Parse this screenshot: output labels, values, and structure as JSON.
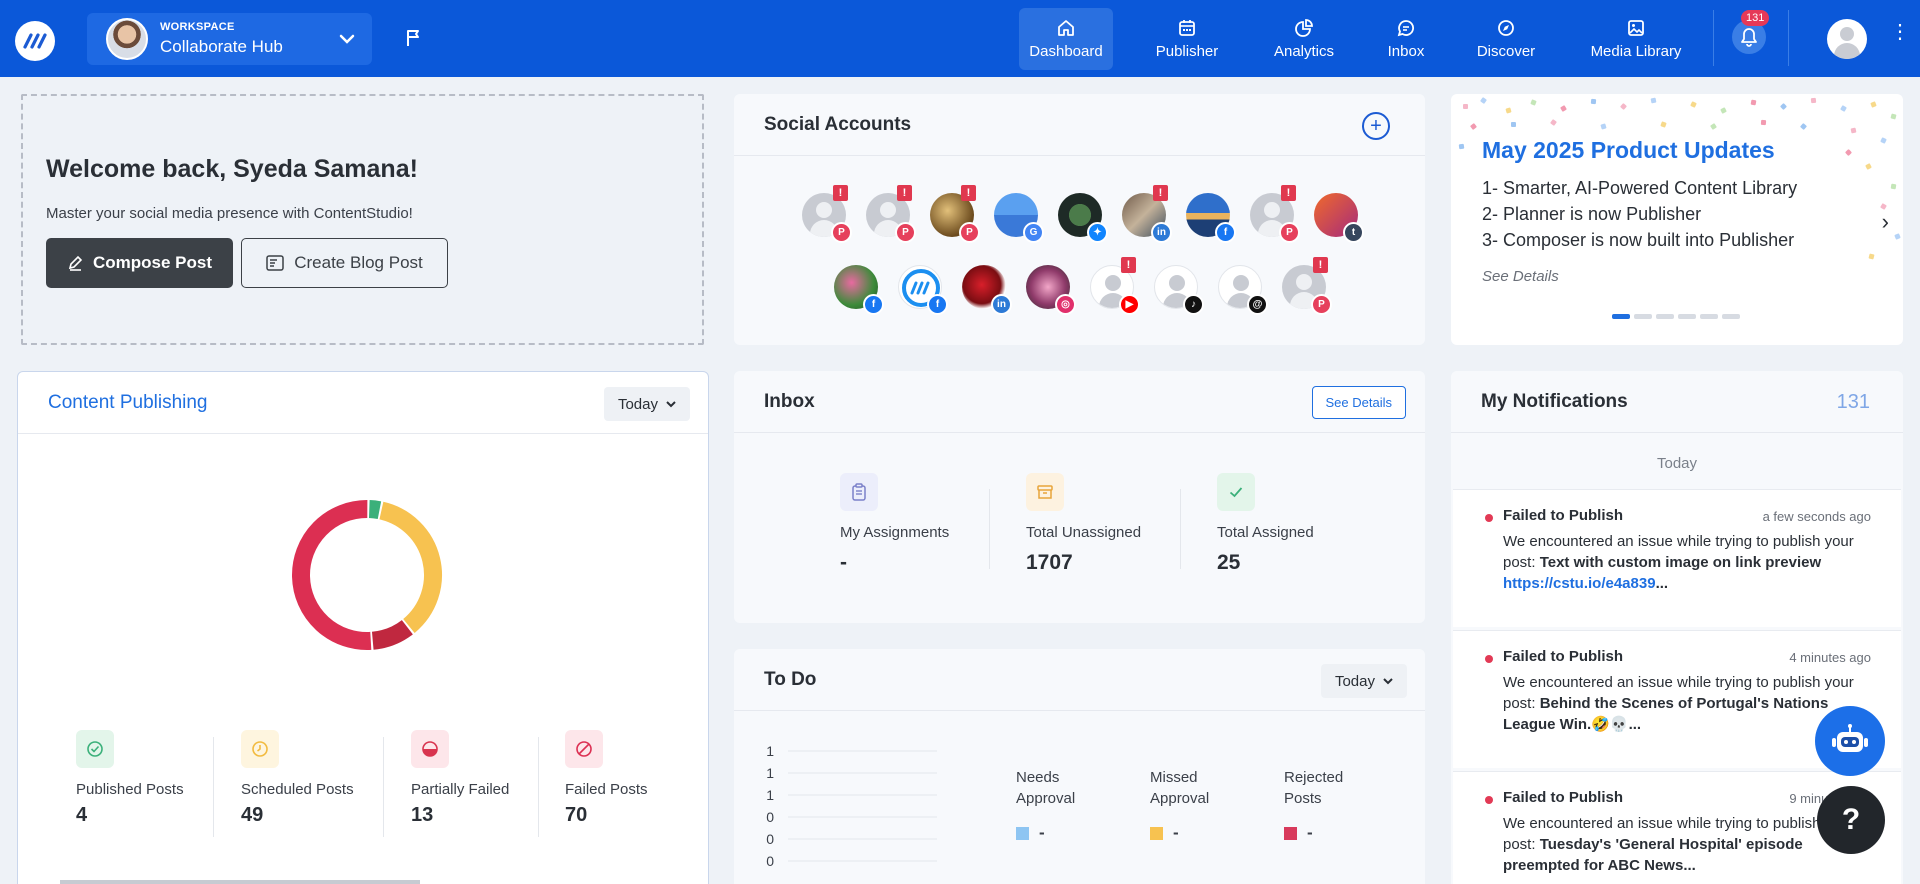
{
  "topbar": {
    "workspace_kicker": "WORKSPACE",
    "workspace_name": "Collaborate Hub",
    "nav": [
      {
        "label": "Dashboard",
        "icon": "home-icon",
        "active": true
      },
      {
        "label": "Publisher",
        "icon": "calendar-icon",
        "active": false
      },
      {
        "label": "Analytics",
        "icon": "pie-chart-icon",
        "active": false
      },
      {
        "label": "Inbox",
        "icon": "chat-icon",
        "active": false
      },
      {
        "label": "Discover",
        "icon": "compass-icon",
        "active": false
      },
      {
        "label": "Media Library",
        "icon": "image-icon",
        "active": false
      }
    ],
    "notification_badge": "131"
  },
  "welcome": {
    "title": "Welcome back, Syeda Samana!",
    "subtitle": "Master your social media presence with ContentStudio!",
    "compose_label": "Compose Post",
    "blog_label": "Create Blog Post"
  },
  "social_accounts": {
    "title": "Social Accounts",
    "add_icon": "plus-circle-icon",
    "row1": [
      {
        "network": "pinterest",
        "warning": true
      },
      {
        "network": "pinterest",
        "warning": true
      },
      {
        "network": "pinterest",
        "warning": true
      },
      {
        "network": "google-business",
        "warning": false
      },
      {
        "network": "bluesky",
        "warning": false
      },
      {
        "network": "linkedin",
        "warning": true
      },
      {
        "network": "facebook",
        "warning": false
      },
      {
        "network": "pinterest",
        "warning": true
      },
      {
        "network": "tumblr",
        "warning": false
      }
    ],
    "row2": [
      {
        "network": "facebook",
        "warning": false
      },
      {
        "network": "facebook",
        "warning": false
      },
      {
        "network": "linkedin",
        "warning": false
      },
      {
        "network": "instagram",
        "warning": false
      },
      {
        "network": "youtube",
        "warning": true
      },
      {
        "network": "tiktok",
        "warning": false
      },
      {
        "network": "threads",
        "warning": false
      },
      {
        "network": "pinterest",
        "warning": true
      }
    ],
    "warning_glyph": "!"
  },
  "product_updates": {
    "title": "May 2025 Product Updates",
    "lines": [
      "1- Smarter, AI-Powered Content Library",
      "2- Planner is now Publisher",
      "3- Composer is now built into Publisher"
    ],
    "see_details": "See Details",
    "slides": 6,
    "active_slide": 1
  },
  "content_publishing": {
    "title": "Content Publishing",
    "period": "Today",
    "stats": [
      {
        "label": "Published Posts",
        "value": "4",
        "color": "#3bb07a",
        "icon": "check-circle-icon"
      },
      {
        "label": "Scheduled Posts",
        "value": "49",
        "color": "#f7c250",
        "icon": "clock-icon"
      },
      {
        "label": "Partially Failed",
        "value": "13",
        "color": "#c0283f",
        "icon": "half-circle-icon"
      },
      {
        "label": "Failed Posts",
        "value": "70",
        "color": "#dc2f52",
        "icon": "ban-icon"
      }
    ]
  },
  "inbox": {
    "title": "Inbox",
    "see_details": "See Details",
    "stats": [
      {
        "label": "My Assignments",
        "value": "-",
        "icon": "clipboard-icon"
      },
      {
        "label": "Total Unassigned",
        "value": "1707",
        "icon": "archive-icon"
      },
      {
        "label": "Total Assigned",
        "value": "25",
        "icon": "check-icon"
      }
    ]
  },
  "todo": {
    "title": "To Do",
    "period": "Today",
    "y_ticks": [
      "1",
      "1",
      "1",
      "0",
      "0",
      "0"
    ],
    "legend": [
      {
        "label1": "Needs",
        "label2": "Approval",
        "value": "-",
        "color": "#8ec5f2"
      },
      {
        "label1": "Missed",
        "label2": "Approval",
        "value": "-",
        "color": "#f7c250"
      },
      {
        "label1": "Rejected",
        "label2": "Posts",
        "value": "-",
        "color": "#d83a5c"
      }
    ]
  },
  "notifications": {
    "title": "My Notifications",
    "count": "131",
    "group": "Today",
    "items": [
      {
        "title": "Failed to Publish",
        "time": "a few seconds ago",
        "prefix": "We encountered an issue while trying to publish your post: ",
        "post": "Text with custom image on link preview",
        "link": "https://cstu.io/e4a839",
        "suffix": "..."
      },
      {
        "title": "Failed to Publish",
        "time": "4 minutes ago",
        "prefix": "We encountered an issue while trying to publish your post: ",
        "post": "Behind the Scenes of Portugal's Nations League Win.🤣💀",
        "link": "",
        "suffix": "..."
      },
      {
        "title": "Failed to Publish",
        "time": "9 minutes ago",
        "prefix": "We encountered an issue while trying to publish your post: ",
        "post": "Tuesday's 'General Hospital' episode preempted for ABC News",
        "link": "",
        "suffix": "..."
      }
    ]
  },
  "floating": {
    "bot_icon": "robot-icon",
    "help_label": "?"
  }
}
